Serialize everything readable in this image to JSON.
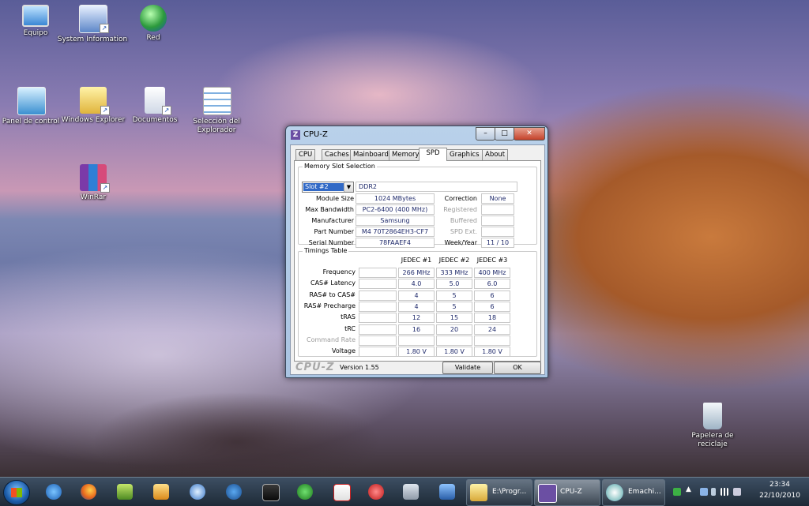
{
  "desktop": {
    "icons": [
      {
        "label": "Equipo",
        "icon": "computer-icon"
      },
      {
        "label": "System Information",
        "icon": "info-icon"
      },
      {
        "label": "Red",
        "icon": "network-globe-icon"
      },
      {
        "label": "Panel de control",
        "icon": "control-panel-icon"
      },
      {
        "label": "Windows Explorer",
        "icon": "folder-icon"
      },
      {
        "label": "Documentos",
        "icon": "documents-icon"
      },
      {
        "label": "Selección del Explorador",
        "icon": "checklist-icon"
      },
      {
        "label": "WinRar",
        "icon": "winrar-icon"
      },
      {
        "label": "Papelera de reciclaje",
        "icon": "recycle-bin-icon"
      }
    ]
  },
  "window": {
    "title": "CPU-Z",
    "tabs": [
      "CPU",
      "Caches",
      "Mainboard",
      "Memory",
      "SPD",
      "Graphics",
      "About"
    ],
    "active_tab": "SPD",
    "slot_group_title": "Memory Slot Selection",
    "slot_selected": "Slot #2",
    "memory_type": "DDR2",
    "fields": {
      "module_size": {
        "label": "Module Size",
        "value": "1024 MBytes"
      },
      "max_bandwidth": {
        "label": "Max Bandwidth",
        "value": "PC2-6400 (400 MHz)"
      },
      "manufacturer": {
        "label": "Manufacturer",
        "value": "Samsung"
      },
      "part_number": {
        "label": "Part Number",
        "value": "M4 70T2864EH3-CF7"
      },
      "serial_number": {
        "label": "Serial Number",
        "value": "78FAAEF4"
      },
      "correction": {
        "label": "Correction",
        "value": "None"
      },
      "registered": {
        "label": "Registered",
        "value": ""
      },
      "buffered": {
        "label": "Buffered",
        "value": ""
      },
      "spd_ext": {
        "label": "SPD Ext.",
        "value": ""
      },
      "week_year": {
        "label": "Week/Year",
        "value": "11 / 10"
      }
    },
    "timings_title": "Timings Table",
    "timing_columns": [
      "JEDEC #1",
      "JEDEC #2",
      "JEDEC #3"
    ],
    "timing_rows": [
      {
        "label": "Frequency",
        "values": [
          "266 MHz",
          "333 MHz",
          "400 MHz"
        ],
        "dim": false
      },
      {
        "label": "CAS# Latency",
        "values": [
          "4.0",
          "5.0",
          "6.0"
        ],
        "dim": false
      },
      {
        "label": "RAS# to CAS#",
        "values": [
          "4",
          "5",
          "6"
        ],
        "dim": false
      },
      {
        "label": "RAS# Precharge",
        "values": [
          "4",
          "5",
          "6"
        ],
        "dim": false
      },
      {
        "label": "tRAS",
        "values": [
          "12",
          "15",
          "18"
        ],
        "dim": false
      },
      {
        "label": "tRC",
        "values": [
          "16",
          "20",
          "24"
        ],
        "dim": false
      },
      {
        "label": "Command Rate",
        "values": [
          "",
          "",
          ""
        ],
        "dim": true
      },
      {
        "label": "Voltage",
        "values": [
          "1.80 V",
          "1.80 V",
          "1.80 V"
        ],
        "dim": false
      }
    ],
    "logo": "CPU-Z",
    "version": "Version 1.55",
    "validate_label": "Validate",
    "ok_label": "OK"
  },
  "taskbar": {
    "pinned": [
      "ie-icon",
      "firefox-icon",
      "tool-icon",
      "media-player-icon",
      "messenger-icon",
      "bs-icon",
      "terminal-icon",
      "tvu-icon",
      "acrobat-icon",
      "power-icon",
      "calculator-icon",
      "network-tool-icon"
    ],
    "buttons": [
      {
        "label": "E:\\Progr...",
        "icon": "folder-icon"
      },
      {
        "label": "CPU-Z",
        "icon": "cpuz-icon"
      },
      {
        "label": "Emachi...",
        "icon": "paint-icon"
      }
    ],
    "clock_time": "23:34",
    "clock_date": "22/10/2010"
  },
  "colors": {
    "accent": "#3169c6",
    "value_text": "#1f2a6b",
    "title_bg": "#b9d1ea"
  }
}
